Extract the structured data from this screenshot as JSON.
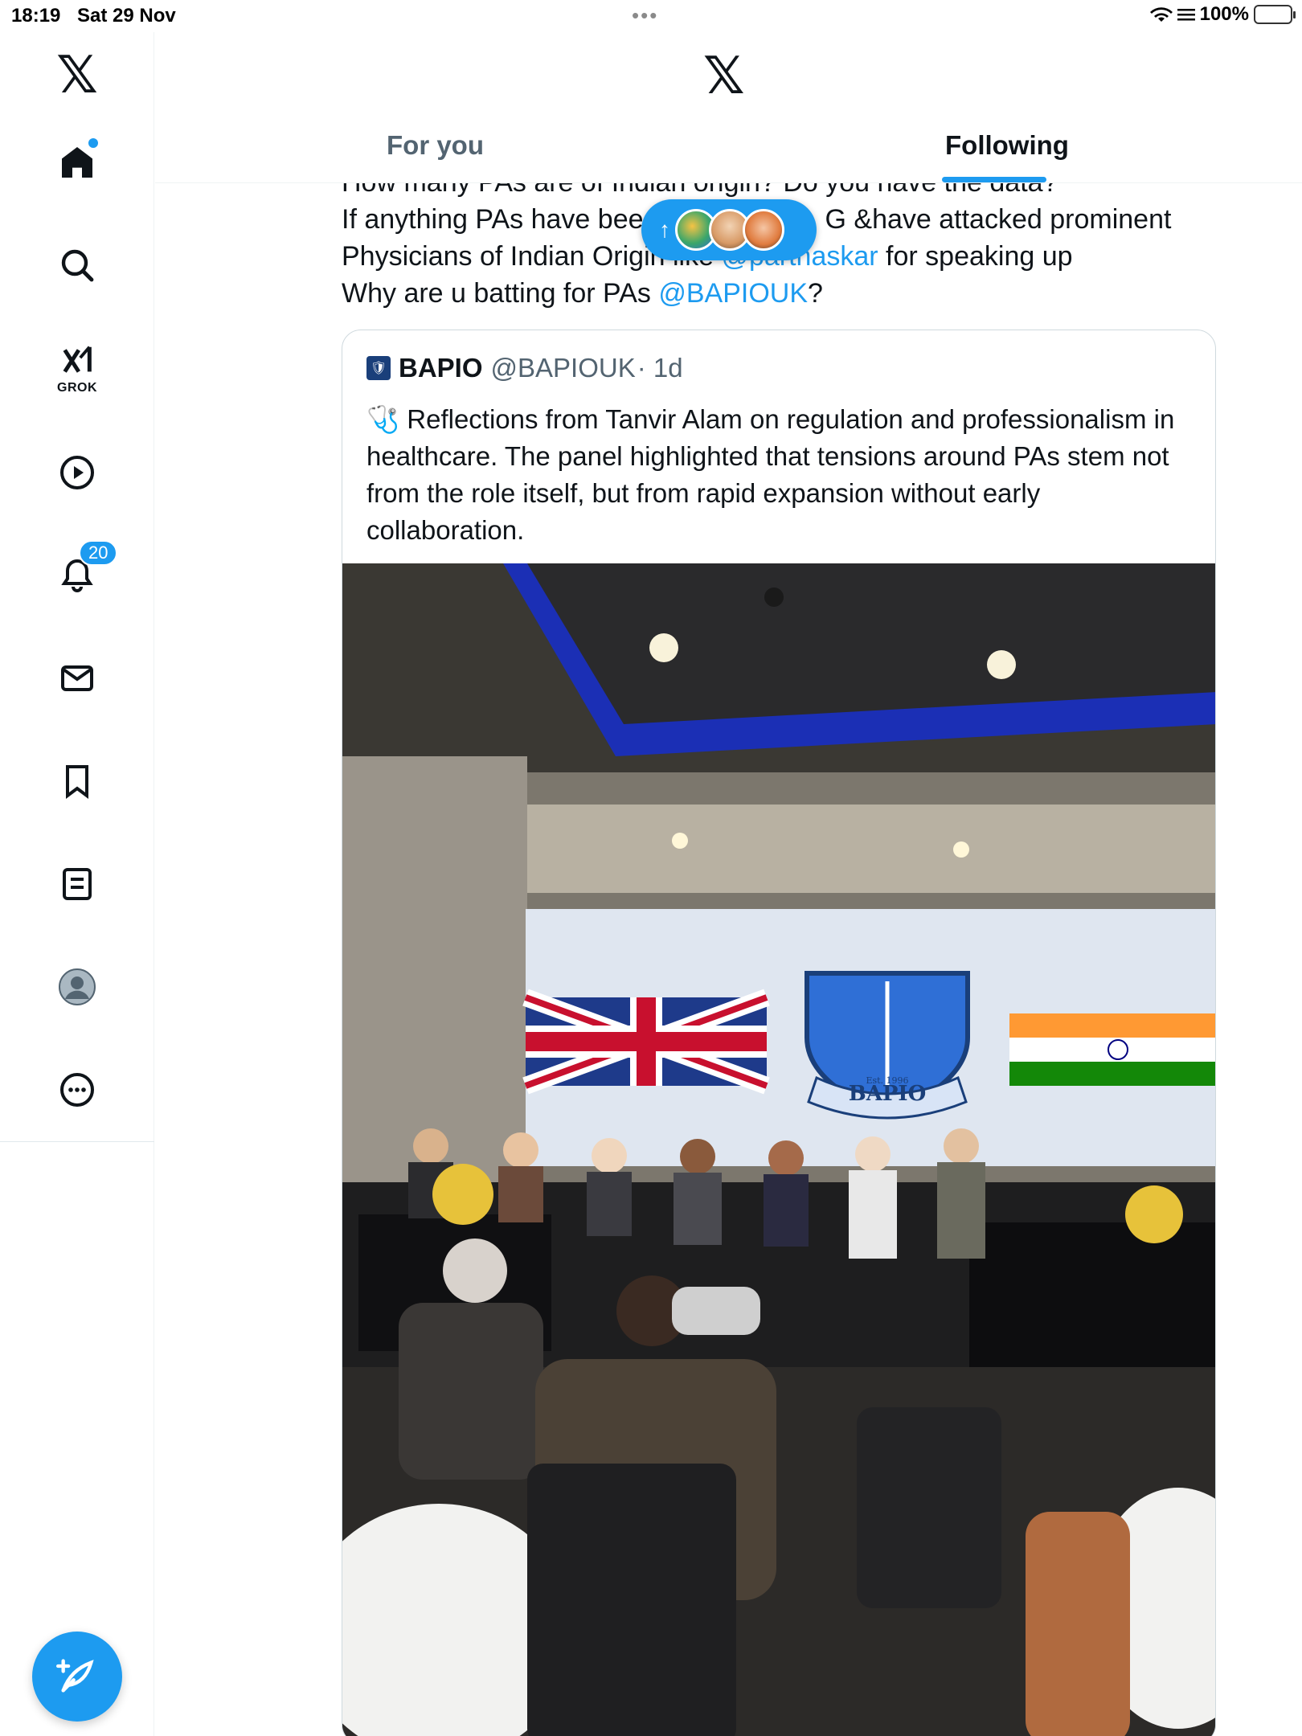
{
  "status_bar": {
    "time": "18:19",
    "date": "Sat 29 Nov",
    "battery": "100%"
  },
  "sidebar": {
    "logo": "𝕏",
    "items": [
      {
        "name": "home",
        "icon": "home-icon"
      },
      {
        "name": "search",
        "icon": "search-icon"
      },
      {
        "name": "grok",
        "icon": "grok-icon",
        "label": "GROK"
      },
      {
        "name": "video",
        "icon": "play-icon"
      },
      {
        "name": "notifications",
        "icon": "bell-icon",
        "badge": "20"
      },
      {
        "name": "messages",
        "icon": "mail-icon"
      },
      {
        "name": "bookmarks",
        "icon": "bookmark-icon"
      },
      {
        "name": "lists",
        "icon": "list-icon"
      },
      {
        "name": "profile",
        "icon": "avatar-icon"
      },
      {
        "name": "more",
        "icon": "more-icon"
      }
    ],
    "compose_icon": "compose-icon"
  },
  "header": {
    "logo": "𝕏",
    "tabs": [
      {
        "label": "For you",
        "active": false
      },
      {
        "label": "Following",
        "active": true
      }
    ]
  },
  "tweet": {
    "line1": "How many PAs are of Indian origin? Do you have the data?",
    "line2_a": "If anything PAs have bee",
    "line2_b": "G &have attacked prominent",
    "line3_a": "Physicians of Indian Origin like ",
    "line3_mention": "@parthaskar",
    "line3_b": " for speaking up",
    "line4_a": "Why are u batting for PAs ",
    "line4_mention": "@BAPIOUK",
    "line4_b": "?"
  },
  "quote": {
    "name": "BAPIO",
    "handle": "@BAPIOUK",
    "time": "· 1d",
    "body": "🩺 Reflections from Tanvir Alam on regulation and professionalism in healthcare. The panel highlighted that tensions around PAs stem not from the role itself, but from rapid expansion without early collaboration.",
    "screen_text": "BAPIO",
    "est_text": "Est. 1996"
  },
  "colors": {
    "accent": "#1d9bf0",
    "text": "#0f1419",
    "muted": "#536471"
  }
}
